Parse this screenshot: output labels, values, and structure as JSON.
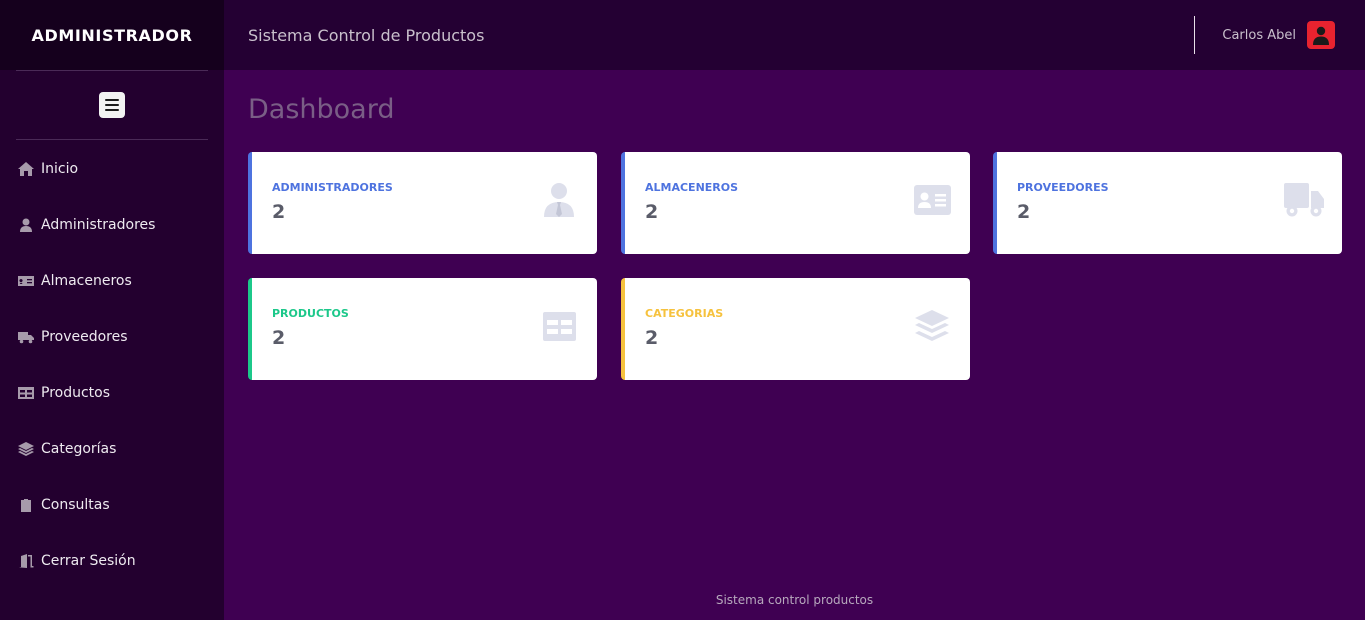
{
  "sidebar": {
    "brand": "ADMINISTRADOR",
    "items": [
      {
        "label": "Inicio",
        "icon": "home-icon"
      },
      {
        "label": "Administradores",
        "icon": "user-icon"
      },
      {
        "label": "Almaceneros",
        "icon": "id-card-icon"
      },
      {
        "label": "Proveedores",
        "icon": "truck-icon"
      },
      {
        "label": "Productos",
        "icon": "table-icon"
      },
      {
        "label": "Categorías",
        "icon": "layers-icon"
      },
      {
        "label": "Consultas",
        "icon": "clipboard-icon"
      },
      {
        "label": "Cerrar Sesión",
        "icon": "door-open-icon"
      }
    ]
  },
  "topbar": {
    "title": "Sistema Control de Productos",
    "user_name": "Carlos Abel",
    "avatar_icon": "user-avatar-icon",
    "avatar_color": "#e8232f"
  },
  "main": {
    "title": "Dashboard",
    "cards": [
      {
        "label": "ADMINISTRADORES",
        "value": "2",
        "color": "#4e73df",
        "icon": "user-tie-icon"
      },
      {
        "label": "ALMACENEROS",
        "value": "2",
        "color": "#4e73df",
        "icon": "id-card-icon"
      },
      {
        "label": "PROVEEDORES",
        "value": "2",
        "color": "#4e73df",
        "icon": "truck-icon"
      },
      {
        "label": "PRODUCTOS",
        "value": "2",
        "color": "#1cc88a",
        "icon": "table-icon"
      },
      {
        "label": "CATEGORIAS",
        "value": "2",
        "color": "#f6c23e",
        "icon": "layers-icon"
      }
    ]
  },
  "footer": {
    "text": "Sistema control productos"
  }
}
